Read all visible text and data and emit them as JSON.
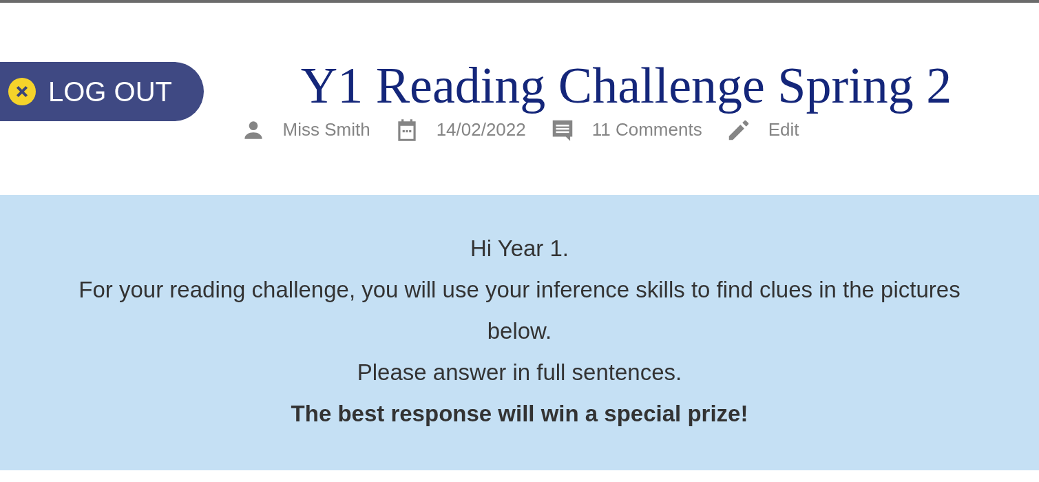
{
  "logout_button": {
    "label": "LOG OUT"
  },
  "post": {
    "title": "Y1 Reading Challenge Spring 2",
    "meta": [
      {
        "kind": "author",
        "text": "Miss Smith"
      },
      {
        "kind": "date",
        "text": "14/02/2022"
      },
      {
        "kind": "comments",
        "text": "11 Comments"
      },
      {
        "kind": "edit",
        "text": "Edit"
      }
    ]
  },
  "content": {
    "lines": [
      {
        "text": "Hi Year 1.",
        "bold": false
      },
      {
        "text": "For your reading challenge, you will use your inference skills to find clues in the pictures below.",
        "bold": false
      },
      {
        "text": "Please answer in full sentences.",
        "bold": false
      },
      {
        "text": "The best response will win a special prize!",
        "bold": true
      }
    ]
  }
}
